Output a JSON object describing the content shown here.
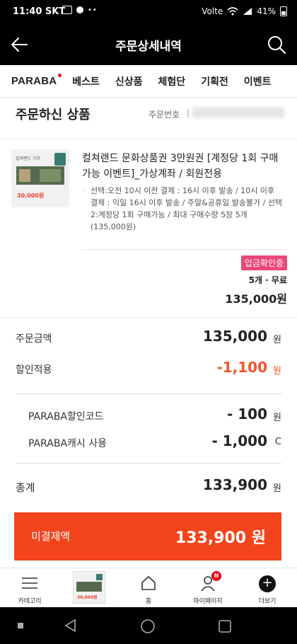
{
  "status_bar": {
    "time": "11:40 SKT",
    "extra_icons": "WON",
    "dots": "••",
    "carrier": "Volte",
    "battery": "41%"
  },
  "header": {
    "title": "주문상세내역",
    "back_icon": "arrow-left-icon",
    "search_icon": "search-icon"
  },
  "nav": {
    "brand": "PARABA",
    "items": [
      "베스트",
      "신상품",
      "체험단",
      "기획전",
      "이벤트"
    ]
  },
  "section": {
    "title": "주문하신 상품",
    "order_no_label": "주문번호",
    "order_no_separator": "|"
  },
  "product": {
    "thumb_price": "30,000원",
    "thumb_title": "컬쳐랜드 기프",
    "name": "컬쳐랜드 문화상품권 3만원권 [계정당 1회 구매가능 이벤트]_가상계좌 / 회원전용",
    "option": "선택:오전 10시 이전 결제 : 16시 이후 발송 / 10시 이후 결제 : 익일 16시 이후 발송 / 주말&공휴일 발송불가 / 선택2:계정당 1회 구매가능 / 최대 구매수량 5장 5개 (135,000원)",
    "status": "입금확인중",
    "quantity_shipping": "5개 · 무료",
    "price": "135,000원"
  },
  "summary": {
    "order_amount_label": "주문금액",
    "order_amount_value": "135,000",
    "order_amount_unit": "원",
    "discount_label": "할인적용",
    "discount_value": "-1,100",
    "discount_unit": "원",
    "coupon_label": "PARABA할인코드",
    "coupon_value": "- 100",
    "coupon_unit": "원",
    "cash_label": "PARABA캐시 사용",
    "cash_value": "- 1,000",
    "cash_unit": "C",
    "total_label": "총계",
    "total_value": "133,900",
    "total_unit": "원"
  },
  "cta": {
    "label": "미결제액",
    "amount": "133,900 원"
  },
  "bottom_nav": {
    "category_label": "카테고리",
    "recent_price": "30,000원",
    "home_label": "홈",
    "mypage_label": "마이페이지",
    "mypage_badge": "N",
    "more_label": "더보기"
  },
  "colors": {
    "accent": "#f3441b",
    "status_badge": "#ea4879",
    "discount": "#f2542d",
    "header_bg": "#000000"
  }
}
